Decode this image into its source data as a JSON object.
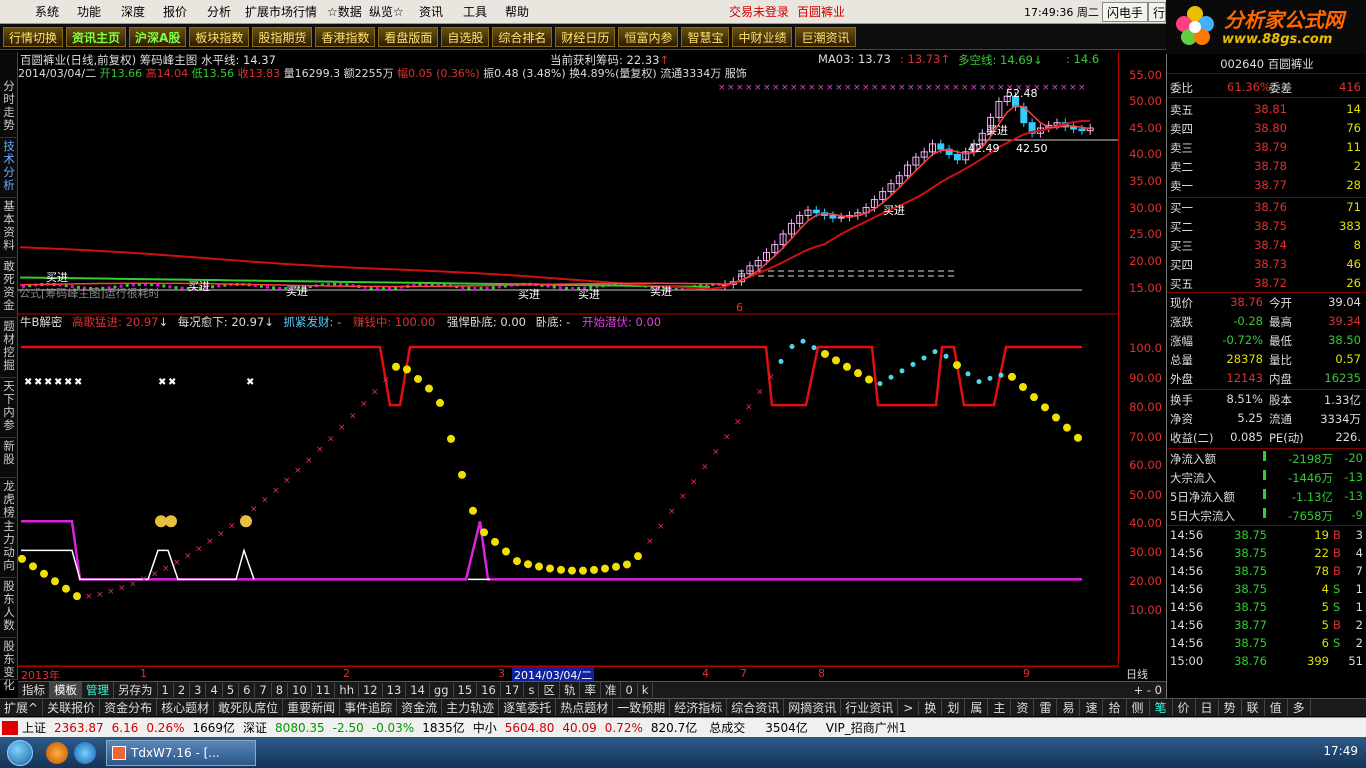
{
  "menu": {
    "items": [
      "系统",
      "功能",
      "深度",
      "报价",
      "分析",
      "扩展市场行情",
      "☆数据",
      "纵览☆",
      "资讯",
      "工具",
      "帮助"
    ],
    "login": "交易未登录",
    "stock": "百圆裤业",
    "clock": "17:49:36 周二",
    "btn1": "闪电手",
    "btn2": "行"
  },
  "logo": {
    "t1": "分析家公式网",
    "t2": "www.88gs.com"
  },
  "toolbar": [
    "行情切换",
    "资讯主页",
    "沪深A股",
    "板块指数",
    "股指期货",
    "香港指数",
    "看盘版面",
    "自选股",
    "综合排名",
    "财经日历",
    "恒富内参",
    "智慧宝",
    "中财业绩",
    "巨潮资讯"
  ],
  "leftnav": [
    "分时走势",
    "技术分析",
    "基本资料",
    "敢死资金",
    "题材挖掘",
    "天下内参",
    "新股",
    "龙虎榜",
    "主力动向",
    "股东人数",
    "股东变化"
  ],
  "main": {
    "title": "百圆裤业(日线,前复权) 筹码峰主图 水平线: 14.37",
    "profit": "当前获利筹码: 22.33",
    "profit_arrow": "↑",
    "ma3": "MA03: 13.73",
    "ma3b": ": 13.73",
    "dkx": "多空线: 14.69",
    "dkx_arrow": "↓",
    "dkx2": ": 14.6",
    "date": "2014/03/04/二",
    "open_l": "开",
    "open": "13.66",
    "high_l": "高",
    "high": "14.04",
    "low_l": "低",
    "low": "13.56",
    "close_l": "收",
    "close": "13.83",
    "vol": "量16299.3",
    "amt": "额2255万",
    "chg_l": "幅",
    "chg": "0.05 (0.36%)",
    "amp": "振0.48 (3.48%)",
    "turn": "换4.89%(量复权)",
    "float": "流通3334万",
    "rest": "服饰",
    "formula_note": "公式[筹码峰主图]运行很耗时",
    "labels": {
      "buy": "买进",
      "p1": "52.48",
      "p2": "42.49",
      "p3": "42.50",
      "mark6": "6",
      "mark8": "8"
    }
  },
  "sub": {
    "name": "牛B解密",
    "s1": "高歌猛进: 20.97",
    "s1a": "↓",
    "s2": "每况愈下: 20.97",
    "s2a": "↓",
    "s3": "抓紧发财: -",
    "s4": "赚钱中: 100.00",
    "s5": "强悍卧底: 0.00",
    "s6": "卧底: -",
    "s7": "开始潜伏: 0.00"
  },
  "axis_main": [
    "55.00",
    "50.00",
    "45.00",
    "40.00",
    "35.00",
    "30.00",
    "25.00",
    "20.00",
    "15.00"
  ],
  "axis_sub": [
    "100.0",
    "90.00",
    "80.00",
    "70.00",
    "60.00",
    "50.00",
    "40.00",
    "30.00",
    "20.00",
    "10.00"
  ],
  "dates": [
    "2013年",
    "1",
    "2",
    "3",
    "2014/03/04/二",
    "4",
    "7",
    "8",
    "9"
  ],
  "day_label": "日线",
  "tabs": [
    "指标",
    "模板",
    "管理",
    "另存为",
    "1",
    "2",
    "3",
    "4",
    "5",
    "6",
    "7",
    "8",
    "10",
    "11",
    "hh",
    "12",
    "13",
    "14",
    "gg",
    "15",
    "16",
    "17",
    "s",
    "区",
    "轨",
    "率",
    "准",
    "0",
    "k"
  ],
  "navrow": [
    "扩展^",
    "关联报价",
    "资金分布",
    "核心题材",
    "敢死队席位",
    "重要新闻",
    "事件追踪",
    "资金流",
    "主力轨迹",
    "逐笔委托",
    "热点题材",
    "一致预期",
    "经济指标",
    "综合资讯",
    "网摘资讯",
    "行业资讯",
    ">",
    "换",
    "划",
    "属",
    "主",
    "资",
    "雷",
    "易",
    "速",
    "拾",
    "侧",
    "笔",
    "价",
    "日",
    "势",
    "联",
    "值",
    "多"
  ],
  "status": {
    "sh_l": "上证",
    "sh": "2363.87",
    "sh_c": "6.16",
    "sh_p": "0.26%",
    "sh_a": "1669亿",
    "sz_l": "深证",
    "sz": "8080.35",
    "sz_c": "-2.50",
    "sz_p": "-0.03%",
    "sz_a": "1835亿",
    "zx_l": "中小",
    "zx": "5604.80",
    "zx_c": "40.09",
    "zx_p": "0.72%",
    "zx_a": "820.7亿",
    "tot_l": "总成交",
    "tot": "3504亿",
    "vip": "VIP_招商广州1"
  },
  "taskbar": {
    "task": "TdxW7.16 - [...",
    "time": "17:49"
  },
  "quote": {
    "code": "002640 百圆裤业",
    "wb_l": "委比",
    "wb": "61.36%",
    "wc_l": "委差",
    "wc": "416",
    "sell": [
      {
        "l": "卖五",
        "p": "38.81",
        "v": "14"
      },
      {
        "l": "卖四",
        "p": "38.80",
        "v": "76"
      },
      {
        "l": "卖三",
        "p": "38.79",
        "v": "11"
      },
      {
        "l": "卖二",
        "p": "38.78",
        "v": "2"
      },
      {
        "l": "卖一",
        "p": "38.77",
        "v": "28"
      }
    ],
    "buy": [
      {
        "l": "买一",
        "p": "38.76",
        "v": "71"
      },
      {
        "l": "买二",
        "p": "38.75",
        "v": "383"
      },
      {
        "l": "买三",
        "p": "38.74",
        "v": "8"
      },
      {
        "l": "买四",
        "p": "38.73",
        "v": "46"
      },
      {
        "l": "买五",
        "p": "38.72",
        "v": "26"
      }
    ],
    "stats": [
      {
        "a": "现价",
        "b": "38.76",
        "c": "今开",
        "d": "39.04"
      },
      {
        "a": "涨跌",
        "b": "-0.28",
        "c": "最高",
        "d": "39.34"
      },
      {
        "a": "涨幅",
        "b": "-0.72%",
        "c": "最低",
        "d": "38.50"
      },
      {
        "a": "总量",
        "b": "28378",
        "c": "量比",
        "d": "0.57"
      },
      {
        "a": "外盘",
        "b": "12143",
        "c": "内盘",
        "d": "16235"
      }
    ],
    "stats2": [
      {
        "a": "换手",
        "b": "8.51%",
        "c": "股本",
        "d": "1.33亿"
      },
      {
        "a": "净资",
        "b": "5.25",
        "c": "流通",
        "d": "3334万"
      },
      {
        "a": "收益(二)",
        "b": "0.085",
        "c": "PE(动)",
        "d": "226."
      }
    ],
    "flow": [
      {
        "l": "净流入额",
        "v": "-2198万",
        "p": "-20"
      },
      {
        "l": "大宗流入",
        "v": "-1446万",
        "p": "-13"
      },
      {
        "l": "5日净流入额",
        "v": "-1.13亿",
        "p": "-13"
      },
      {
        "l": "5日大宗流入",
        "v": "-7658万",
        "p": "-9"
      }
    ],
    "ticks": [
      {
        "t": "14:56",
        "p": "38.75",
        "v": "19",
        "d": "B",
        "n": "3"
      },
      {
        "t": "14:56",
        "p": "38.75",
        "v": "22",
        "d": "B",
        "n": "4"
      },
      {
        "t": "14:56",
        "p": "38.75",
        "v": "78",
        "d": "B",
        "n": "7"
      },
      {
        "t": "14:56",
        "p": "38.75",
        "v": "4",
        "d": "S",
        "n": "1"
      },
      {
        "t": "14:56",
        "p": "38.75",
        "v": "5",
        "d": "S",
        "n": "1"
      },
      {
        "t": "14:56",
        "p": "38.77",
        "v": "5",
        "d": "B",
        "n": "2"
      },
      {
        "t": "14:56",
        "p": "38.75",
        "v": "6",
        "d": "S",
        "n": "2"
      },
      {
        "t": "15:00",
        "p": "38.76",
        "v": "399",
        "d": "",
        "n": "51"
      }
    ]
  }
}
